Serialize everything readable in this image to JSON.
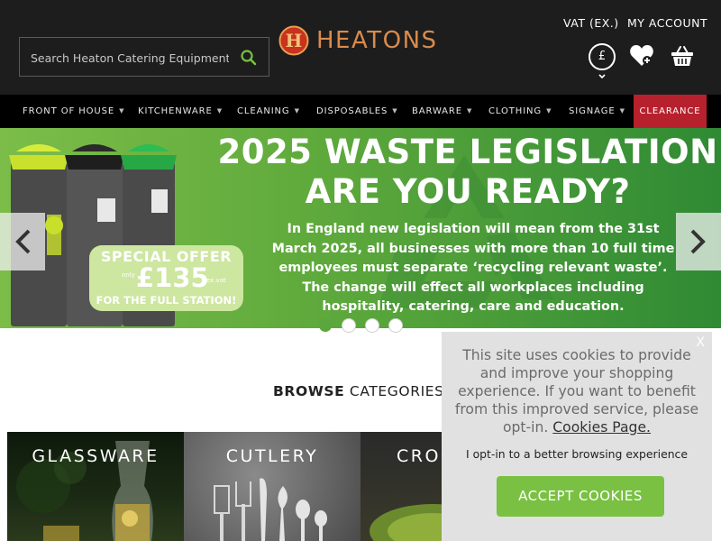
{
  "header": {
    "search_placeholder": "Search Heaton Catering Equipment...",
    "logo_text": "HEATONS",
    "logo_letter": "H",
    "vat_label": "VAT (EX.)",
    "account_label": "MY ACCOUNT",
    "currency_symbol": "£"
  },
  "nav": {
    "items": [
      {
        "label": "FRONT OF HOUSE"
      },
      {
        "label": "KITCHENWARE"
      },
      {
        "label": "CLEANING"
      },
      {
        "label": "DISPOSABLES"
      },
      {
        "label": "BARWARE"
      },
      {
        "label": "CLOTHING"
      },
      {
        "label": "SIGNAGE"
      }
    ],
    "clearance_label": "CLEARANCE"
  },
  "banner": {
    "title_line1": "2025 WASTE LEGISLATION",
    "title_line2": "ARE YOU READY?",
    "body": "In England new legislation will mean from the 31st March 2025, all businesses with more than 10 full time employees must separate ‘recycling relevant waste’. The change will effect all workplaces including hospitality, catering, care and education.",
    "offer_line1": "SPECIAL OFFER",
    "offer_only": "only",
    "offer_price": "£135",
    "offer_vat": "ex.vat",
    "offer_line2": "FOR THE FULL STATION!",
    "slide_count": 4,
    "active_slide": 1
  },
  "browse": {
    "heading_bold": "BROWSE",
    "heading_rest": " CATEGORIES"
  },
  "categories": [
    {
      "label": "GLASSWARE"
    },
    {
      "label": "CUTLERY"
    },
    {
      "label": "CROCKERY"
    }
  ],
  "cookie": {
    "close": "X",
    "text": "This site uses cookies to provide and improve your shopping experience. If you want to benefit from this improved service, please opt-in. ",
    "link": "Cookies Page.",
    "optin": "I opt-in to a better browsing experience",
    "button": "ACCEPT COOKIES"
  },
  "colors": {
    "header_bg": "#1d1d1d",
    "nav_bg": "#000000",
    "clearance_bg": "#b7212d",
    "brand_orange": "#d98b4c",
    "banner_green": "#5ea93c",
    "accept_green": "#7ac143"
  }
}
